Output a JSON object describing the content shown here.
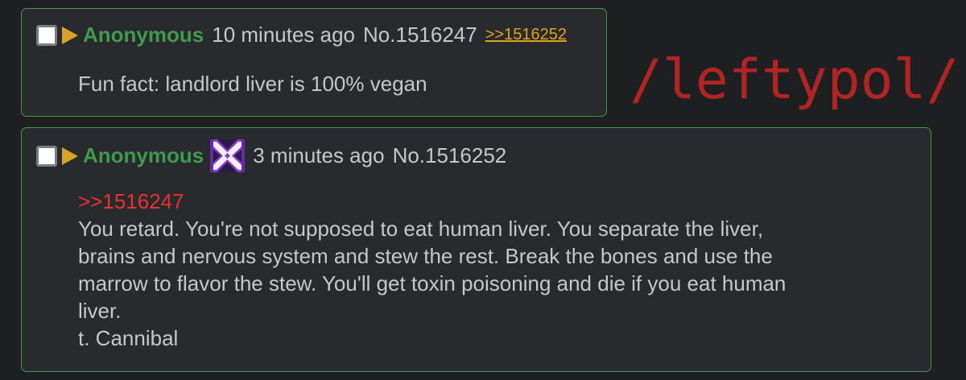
{
  "board_tag": "/leftypol/",
  "posts": [
    {
      "name": "Anonymous",
      "time": "10 minutes ago",
      "post_number": "No.1516247",
      "backlink": ">>1516252",
      "body_lines": [
        "Fun fact: landlord liver is 100% vegan"
      ]
    },
    {
      "name": "Anonymous",
      "flag_icon": "polygon-flag-icon",
      "time": "3 minutes ago",
      "post_number": "No.1516252",
      "quote": ">>1516247",
      "body_lines": [
        "You retard. You're not supposed to eat human liver. You separate the liver,",
        "brains and nervous system and stew the rest. Break the bones and use the",
        "marrow to flavor the stew. You'll get toxin poisoning and die if you eat human",
        "liver.",
        "t. Cannibal"
      ]
    }
  ],
  "colors": {
    "background": "#1d1f21",
    "post_background": "#282a2e",
    "post_border": "#3e9a48",
    "name": "#3f9a4c",
    "text": "#c5c8c6",
    "backlink": "#e0a31c",
    "quotelink": "#e8322f",
    "board_tag": "#b02424",
    "triangle": "#d6a22a"
  }
}
